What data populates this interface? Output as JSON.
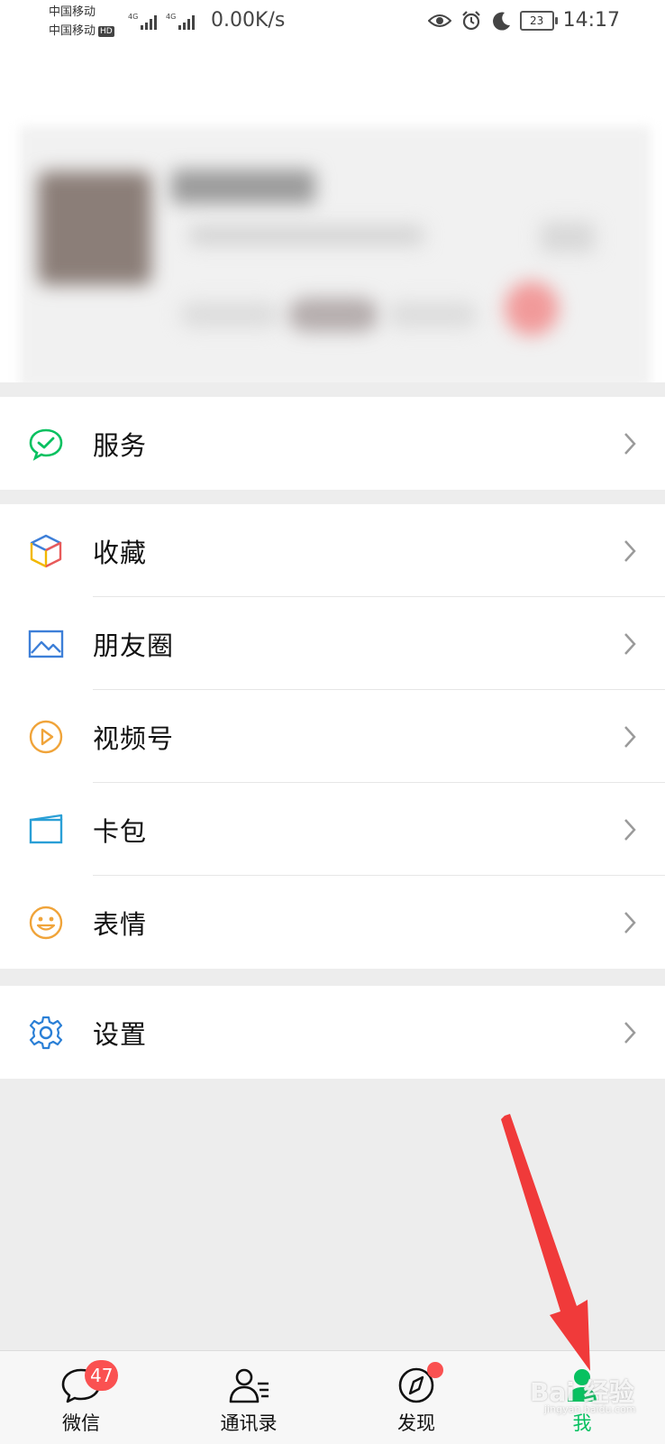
{
  "status_bar": {
    "carrier_1": "中国移动",
    "carrier_2": "中国移动",
    "hd_badge": "HD",
    "net_type_1": "4G",
    "net_type_2": "4G",
    "net_speed": "0.00K/s",
    "battery_level": "23",
    "time": "14:17"
  },
  "menu": {
    "services": {
      "label": "服务",
      "icon": "services-icon",
      "color": "#07c160"
    },
    "main_items": [
      {
        "label": "收藏",
        "icon": "favorites-icon"
      },
      {
        "label": "朋友圈",
        "icon": "moments-icon"
      },
      {
        "label": "视频号",
        "icon": "channels-icon"
      },
      {
        "label": "卡包",
        "icon": "card-wallet-icon"
      },
      {
        "label": "表情",
        "icon": "stickers-icon"
      }
    ],
    "settings": {
      "label": "设置",
      "icon": "settings-icon"
    }
  },
  "tab_bar": {
    "tabs": [
      {
        "label": "微信",
        "icon": "chat-icon",
        "badge": "47"
      },
      {
        "label": "通讯录",
        "icon": "contacts-icon"
      },
      {
        "label": "发现",
        "icon": "discover-icon"
      },
      {
        "label": "我",
        "icon": "me-icon"
      }
    ],
    "active_tab": "我",
    "accent_color": "#07c160",
    "badge_color": "#fa5151"
  },
  "watermark": {
    "text": "Bai 经验",
    "sub": "jingyan.baidu.com"
  }
}
